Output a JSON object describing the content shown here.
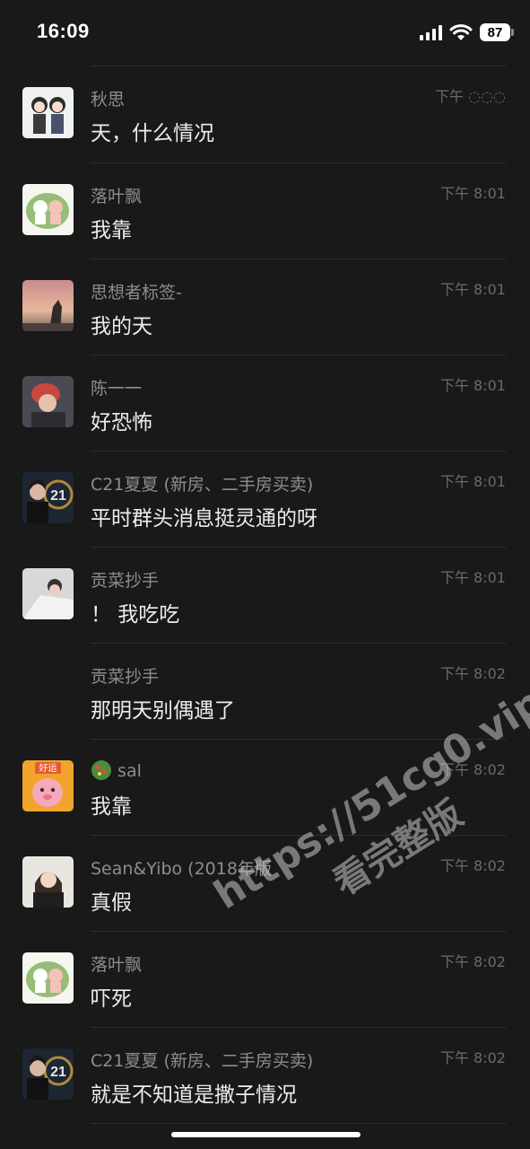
{
  "status_bar": {
    "time": "16:09",
    "battery": "87"
  },
  "messages": [
    {
      "name": "秋思",
      "text": "天，什么情况",
      "time": "下午 ◌◌◌"
    },
    {
      "name": "落叶飘",
      "text": "我靠",
      "time": "下午 8:01"
    },
    {
      "name": "思想者标签-",
      "text": "我的天",
      "time": "下午 8:01"
    },
    {
      "name": "陈一一",
      "text": "好恐怖",
      "time": "下午 8:01"
    },
    {
      "name": "C21夏夏 (新房、二手房买卖)",
      "text": "平时群头消息挺灵通的呀",
      "time": "下午 8:01"
    },
    {
      "name": "贡菜抄手",
      "text": "！ 我吃吃",
      "time": "下午 8:01"
    },
    {
      "name": "贡菜抄手",
      "text": "那明天别偶遇了",
      "time": "下午 8:02"
    },
    {
      "name": "sal",
      "text": "我靠",
      "time": "下午 8:02"
    },
    {
      "name": "Sean&Yibo (2018年版",
      "text": "真假",
      "time": "下午 8:02"
    },
    {
      "name": "落叶飘",
      "text": "吓死",
      "time": "下午 8:02"
    },
    {
      "name": "C21夏夏 (新房、二手房买卖)",
      "text": "就是不知道是撒子情况",
      "time": "下午 8:02"
    }
  ],
  "avatar_badges": {
    "haoyun": "好运",
    "c21": "21"
  },
  "watermark": {
    "line1": "https://51cg0.vip",
    "line2": "看完整版"
  },
  "colors": {
    "background": "#191919",
    "name": "#8d8d8d",
    "text": "#ececec",
    "time": "#6a6a6a"
  }
}
